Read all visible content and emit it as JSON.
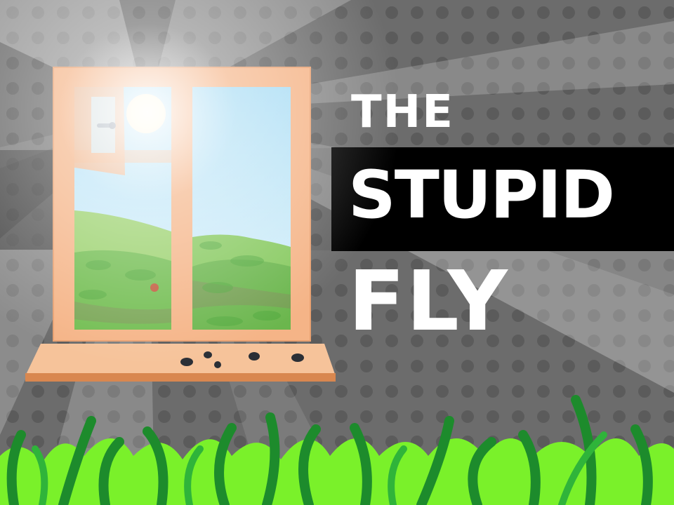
{
  "title": {
    "line1": "THE",
    "line2": "STUPID",
    "line3": "FLY"
  },
  "colors": {
    "background": "#6e6e6e",
    "dots": "#5a5a5a",
    "title_band": "#000000",
    "title_text": "#ffffff",
    "window_frame": "#f7b98a",
    "sky": "#bfe6f7",
    "hills": "#7cc35a",
    "grass_light": "#7bf22a",
    "grass_dark": "#1e8a2e"
  },
  "scene": {
    "window_state": "open",
    "sun": "sun-icon",
    "flies_on_sill": 5,
    "fly_outside": 1
  }
}
